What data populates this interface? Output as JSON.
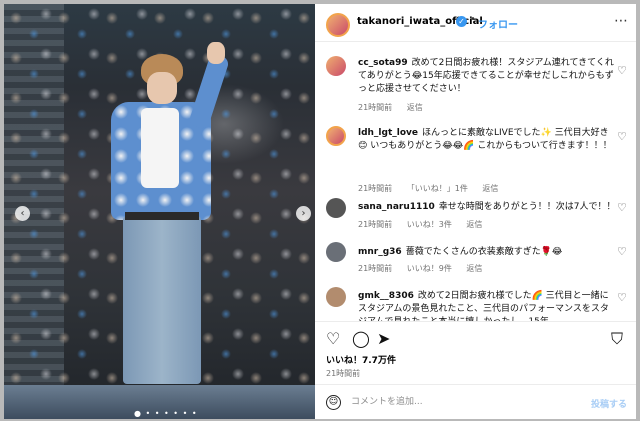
{
  "post": {
    "username": "takanori_iwata_official",
    "follow_label": "フォロー",
    "separator": "•",
    "more_icon": "more-horizontal-icon",
    "likes": "いいね！7.7万件",
    "time": "21時間前"
  },
  "comments": [
    {
      "user": "cc_sota99",
      "text": "改めて2日間お疲れ様！スタジアム連れてきてくれてありがとう😂15年応援できてることが幸せだしこれからもずっと応援させてください！",
      "time": "21時間前",
      "reply": "返信",
      "likes": ""
    },
    {
      "user": "ldh_lgt_love",
      "text": "ほんっとに素敵なLIVEでした✨ 三代目大好き😊 いつもありがとう😂😂🌈 これからもついて行きます！！！",
      "time": "21時間前",
      "reply": "返信",
      "likes": "「いいね！」1件"
    },
    {
      "user": "sana_naru1110",
      "text": "幸せな時間をありがとう！！次は7人で！！",
      "time": "21時間前",
      "reply": "返信",
      "likes": "いいね！3件"
    },
    {
      "user": "mnr_g36",
      "text": "薔薇でたくさんの衣装素敵すぎた🌹😂",
      "time": "21時間前",
      "reply": "返信",
      "likes": "いいね！9件"
    },
    {
      "user": "gmk__8306",
      "text": "改めて2日間お疲れ様でした🌈 三代目と一緒にスタジアムの景色見れたこと、三代目のパフォーマンスをスタジアムで見れたこと本当に嬉しかったし、15年",
      "time": "",
      "reply": "",
      "likes": ""
    }
  ],
  "composer": {
    "placeholder": "コメントを追加...",
    "post_label": "投稿する"
  },
  "icons": {
    "heart": "heart-icon",
    "comment": "comment-icon",
    "share": "share-icon",
    "bookmark": "bookmark-icon",
    "emoji": "emoji-icon",
    "prev": "chevron-left-icon",
    "next": "chevron-right-icon"
  },
  "colors": {
    "accent": "#3897f0",
    "muted": "#737373"
  }
}
